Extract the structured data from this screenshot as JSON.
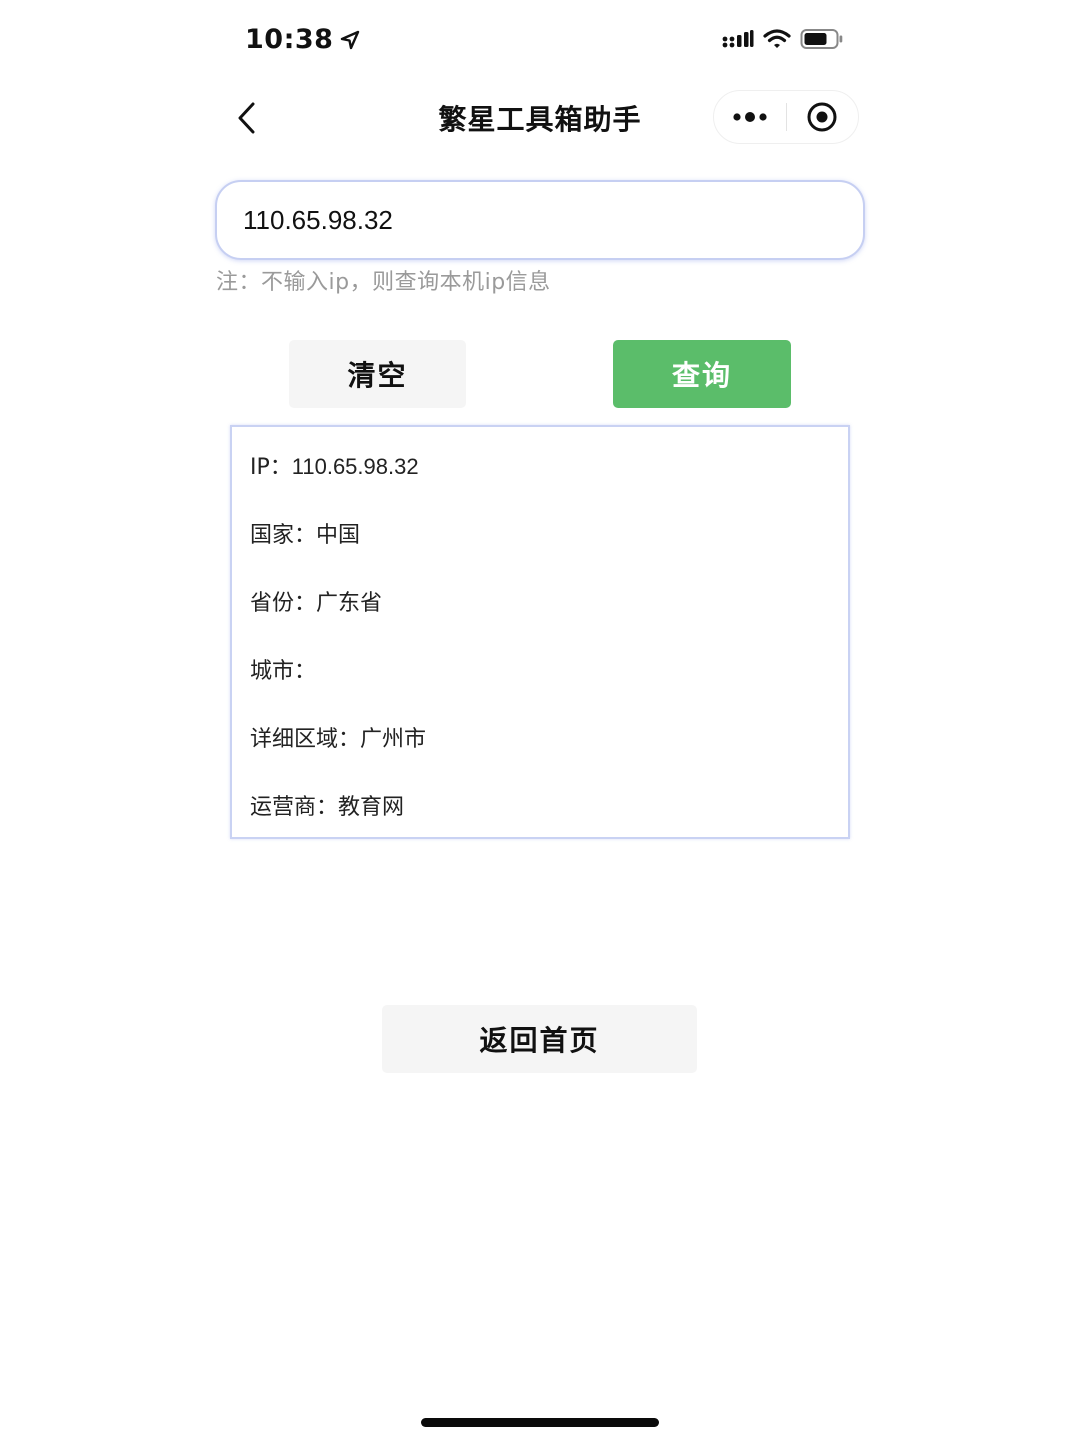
{
  "status_bar": {
    "time": "10:38",
    "location_icon": "location-arrow-icon",
    "signal_icon": "cellular-signal-icon",
    "wifi_icon": "wifi-icon",
    "battery_icon": "battery-icon"
  },
  "nav": {
    "back_icon": "chevron-left-icon",
    "title": "繁星工具箱助手",
    "more_icon": "more-dots-icon",
    "close_icon": "target-circle-icon"
  },
  "query": {
    "ip_value": "110.65.98.32",
    "note": "注：不输入ip，则查询本机ip信息"
  },
  "buttons": {
    "clear_label": "清空",
    "query_label": "查询",
    "home_label": "返回首页"
  },
  "result": {
    "rows": [
      {
        "label": "IP：",
        "value": "110.65.98.32"
      },
      {
        "label": "国家：",
        "value": "中国"
      },
      {
        "label": "省份：",
        "value": "广东省"
      },
      {
        "label": "城市：",
        "value": ""
      },
      {
        "label": "详细区域：",
        "value": "广州市"
      },
      {
        "label": "运营商：",
        "value": "教育网"
      }
    ]
  },
  "colors": {
    "accent_green": "#5bbd6a",
    "input_border": "#c6cff2",
    "note_gray": "#9a9a9a",
    "button_gray": "#f5f5f5"
  }
}
